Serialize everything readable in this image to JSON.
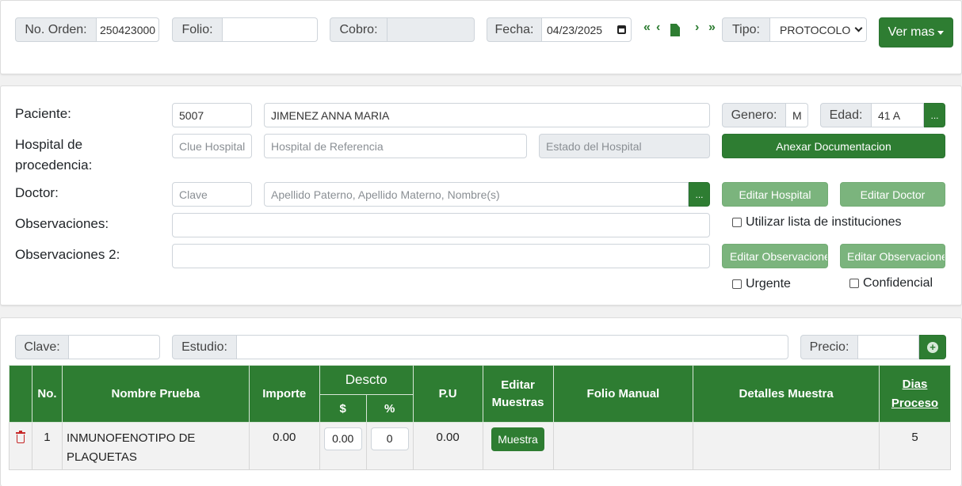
{
  "header": {
    "orden_label": "No. Orden:",
    "orden_value": "250423000",
    "folio_label": "Folio:",
    "folio_value": "",
    "cobro_label": "Cobro:",
    "cobro_value": "",
    "fecha_label": "Fecha:",
    "fecha_value": "04/23/2025",
    "nav": {
      "first": "«",
      "prev": "‹",
      "next": "›",
      "last": "»"
    },
    "tipo_label": "Tipo:",
    "tipo_value": "PROTOCOLO",
    "ver_mas": "Ver mas"
  },
  "patient": {
    "paciente_label": "Paciente:",
    "paciente_id": "5007",
    "paciente_name": "JIMENEZ ANNA MARIA",
    "genero_label": "Genero:",
    "genero_value": "M",
    "edad_label": "Edad:",
    "edad_value": "41 A",
    "dots": "...",
    "hospital_label_1": "Hospital de",
    "hospital_label_2": "procedencia:",
    "hospital_clave_ph": "Clue Hospital",
    "hospital_ref_ph": "Hospital de Referencia",
    "hospital_estado_ph": "Estado del Hospital",
    "anexar": "Anexar Documentacion",
    "doctor_label": "Doctor:",
    "doctor_clave_ph": "Clave",
    "doctor_name_ph": "Apellido Paterno, Apellido Materno, Nombre(s)",
    "editar_hospital": "Editar Hospital",
    "editar_doctor": "Editar Doctor",
    "observaciones_label": "Observaciones:",
    "utilizar_lista": "Utilizar lista de instituciones",
    "observaciones2_label": "Observaciones 2:",
    "editar_obs1": "Editar Observaciones",
    "editar_obs2": "Editar Observaciones",
    "urgente": "Urgente",
    "confidencial": "Confidencial"
  },
  "study": {
    "clave_label": "Clave:",
    "estudio_label": "Estudio:",
    "precio_label": "Precio:"
  },
  "table": {
    "headers": {
      "no": "No.",
      "nombre": "Nombre Prueba",
      "importe": "Importe",
      "descto": "Descto",
      "dollar": "$",
      "percent": "%",
      "pu": "P.U",
      "editar_1": "Editar",
      "editar_2": "Muestras",
      "folio": "Folio Manual",
      "detalles": "Detalles Muestra",
      "dias_1": "Dias",
      "dias_2": "Proceso"
    },
    "rows": [
      {
        "no": "1",
        "nombre_1": "INMUNOFENOTIPO DE",
        "nombre_2": "PLAQUETAS",
        "importe": "0.00",
        "descto_dollar": "0.00",
        "descto_percent": "0",
        "pu": "0.00",
        "muestra_btn": "Muestra",
        "folio": "",
        "detalles": "",
        "dias": "5"
      }
    ]
  },
  "colors": {
    "accent": "#2e7d32",
    "accent_light": "#7bb47d",
    "delete": "#c62828"
  }
}
